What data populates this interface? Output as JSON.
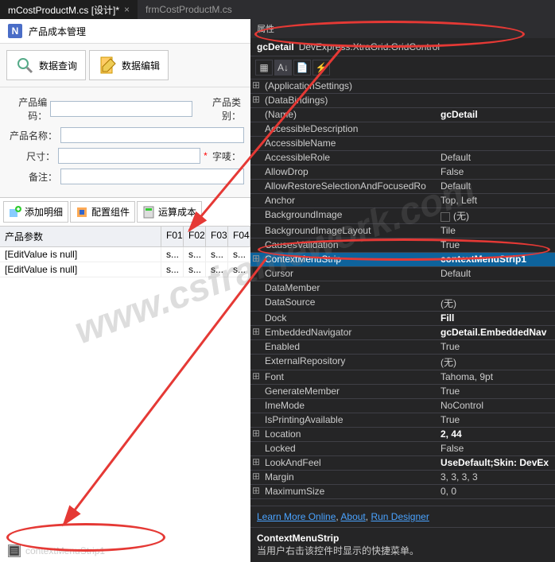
{
  "tabs": [
    {
      "label": "mCostProductM.cs [设计]*",
      "active": true
    },
    {
      "label": "frmCostProductM.cs",
      "active": false
    }
  ],
  "form": {
    "logo": "N",
    "title": "产品成本管理",
    "toolbar": {
      "query": "数据查询",
      "edit": "数据编辑"
    },
    "fields": {
      "product_code": "产品编码：",
      "product_type": "产品类别：",
      "product_name": "产品名称：",
      "size": "尺寸：",
      "font_num": "字唛：",
      "remark": "备注："
    },
    "grid_toolbar": {
      "add_detail": "添加明细",
      "config_component": "配置组件",
      "calc_cost": "运算成本"
    },
    "grid": {
      "headers": {
        "params": "产品参数",
        "f01": "F01",
        "f02": "F02",
        "f03": "F03",
        "f04": "F04"
      },
      "rows": [
        {
          "params": "[EditValue is null]",
          "v": "s..."
        },
        {
          "params": "[EditValue is null]",
          "v": "s..."
        }
      ]
    }
  },
  "component_tray": {
    "name": "contextMenuStrip1"
  },
  "properties": {
    "panel_title": "属性",
    "object_name": "gcDetail",
    "object_type": "DevExpress.XtraGrid.GridControl",
    "groups": [
      {
        "expand": "⊞",
        "name": "(ApplicationSettings)",
        "value": ""
      },
      {
        "expand": "⊞",
        "name": "(DataBindings)",
        "value": ""
      },
      {
        "expand": "",
        "name": "(Name)",
        "value": "gcDetail",
        "bold": true
      },
      {
        "expand": "",
        "name": "AccessibleDescription",
        "value": ""
      },
      {
        "expand": "",
        "name": "AccessibleName",
        "value": ""
      },
      {
        "expand": "",
        "name": "AccessibleRole",
        "value": "Default"
      },
      {
        "expand": "",
        "name": "AllowDrop",
        "value": "False"
      },
      {
        "expand": "",
        "name": "AllowRestoreSelectionAndFocusedRo",
        "value": "Default"
      },
      {
        "expand": "",
        "name": "Anchor",
        "value": "Top, Left"
      },
      {
        "expand": "",
        "name": "BackgroundImage",
        "value": "(无)",
        "swatch": true
      },
      {
        "expand": "",
        "name": "BackgroundImageLayout",
        "value": "Tile"
      },
      {
        "expand": "",
        "name": "CausesValidation",
        "value": "True"
      },
      {
        "expand": "⊞",
        "name": "ContextMenuStrip",
        "value": "contextMenuStrip1",
        "selected": true
      },
      {
        "expand": "",
        "name": "Cursor",
        "value": "Default"
      },
      {
        "expand": "",
        "name": "DataMember",
        "value": ""
      },
      {
        "expand": "",
        "name": "DataSource",
        "value": "(无)"
      },
      {
        "expand": "",
        "name": "Dock",
        "value": "Fill",
        "bold": true
      },
      {
        "expand": "⊞",
        "name": "EmbeddedNavigator",
        "value": "gcDetail.EmbeddedNav",
        "bold": true
      },
      {
        "expand": "",
        "name": "Enabled",
        "value": "True"
      },
      {
        "expand": "",
        "name": "ExternalRepository",
        "value": "(无)"
      },
      {
        "expand": "⊞",
        "name": "Font",
        "value": "Tahoma, 9pt"
      },
      {
        "expand": "",
        "name": "GenerateMember",
        "value": "True"
      },
      {
        "expand": "",
        "name": "ImeMode",
        "value": "NoControl"
      },
      {
        "expand": "",
        "name": "IsPrintingAvailable",
        "value": "True"
      },
      {
        "expand": "⊞",
        "name": "Location",
        "value": "2, 44",
        "bold": true
      },
      {
        "expand": "",
        "name": "Locked",
        "value": "False"
      },
      {
        "expand": "⊞",
        "name": "LookAndFeel",
        "value": "UseDefault;Skin: DevEx",
        "bold": true
      },
      {
        "expand": "⊞",
        "name": "Margin",
        "value": "3, 3, 3, 3"
      },
      {
        "expand": "⊞",
        "name": "MaximumSize",
        "value": "0, 0"
      }
    ],
    "links": {
      "learn": "Learn More Online",
      "about": "About",
      "run": "Run Designer"
    },
    "description": {
      "title": "ContextMenuStrip",
      "text": "当用户右击该控件时显示的快捷菜单。"
    }
  },
  "watermark": "www.csframework.com"
}
